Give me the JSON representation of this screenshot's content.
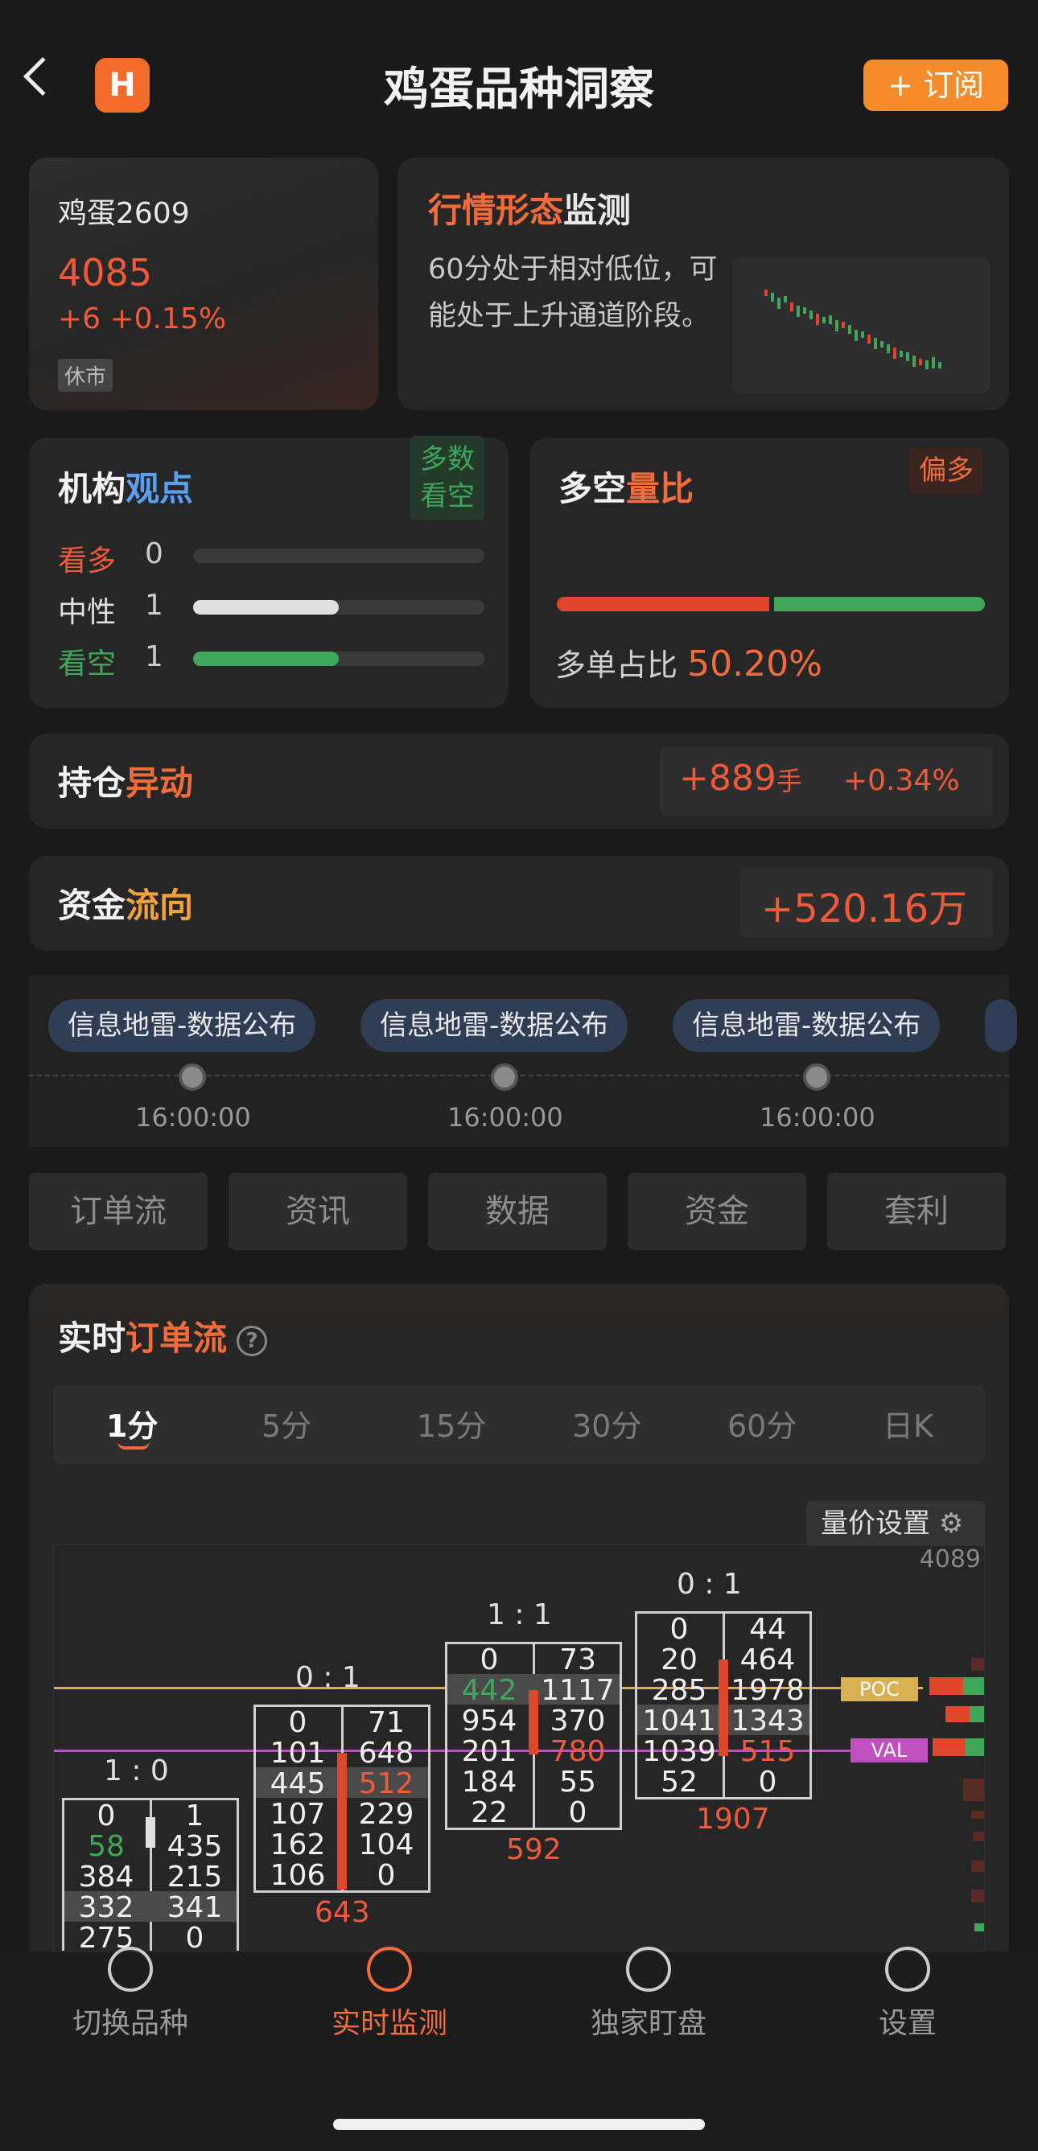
{
  "header": {
    "title": "鸡蛋品种洞察",
    "subscribe_label": "+ 订阅",
    "logo_glyph": "H"
  },
  "price_card": {
    "name": "鸡蛋2609",
    "price": "4085",
    "change": "+6 +0.15%",
    "status": "休市"
  },
  "monitor": {
    "title_a": "行情形态",
    "title_b": "监测",
    "text": "60分处于相对低位，可能处于上升通道阶段。"
  },
  "opinion": {
    "title_a": "机构",
    "title_b": "观点",
    "tag": "多数看空",
    "rows": [
      {
        "label": "看多",
        "count": "0",
        "fraction": 0.0,
        "color": "#f05a3a"
      },
      {
        "label": "中性",
        "count": "1",
        "fraction": 0.5,
        "color": "#e0e0e0"
      },
      {
        "label": "看空",
        "count": "1",
        "fraction": 0.5,
        "color": "#3fa65a"
      }
    ]
  },
  "ratio": {
    "title_a": "多空",
    "title_b": "量比",
    "tag": "偏多",
    "long_label": "多单占比",
    "long_value": "50.20%",
    "long_fraction": 0.502
  },
  "position": {
    "title_a": "持仓",
    "title_b": "异动",
    "value": "+889",
    "unit": "手",
    "pct": "+0.34%"
  },
  "fund": {
    "title_a": "资金",
    "title_b": "流向",
    "value": "+520.16万"
  },
  "timeline": [
    {
      "label": "信息地雷-数据公布",
      "time": "16:00:00"
    },
    {
      "label": "信息地雷-数据公布",
      "time": "16:00:00"
    },
    {
      "label": "信息地雷-数据公布",
      "time": "16:00:00"
    }
  ],
  "tabs": [
    "订单流",
    "资讯",
    "数据",
    "资金",
    "套利"
  ],
  "orderflow": {
    "title_a": "实时",
    "title_b": "订单流",
    "periods": [
      "1分",
      "5分",
      "15分",
      "30分",
      "60分",
      "日K"
    ],
    "active_period": "1分",
    "settings_label": "量价设置",
    "top_price": "4089",
    "poc_label": "POC",
    "val_label": "VAL",
    "candles": [
      {
        "ratio": "1 : 0",
        "total": "",
        "rows": [
          [
            "0",
            "1"
          ],
          [
            "58",
            "435"
          ],
          [
            "384",
            "215"
          ],
          [
            "332",
            "341"
          ],
          [
            "275",
            "0"
          ]
        ]
      },
      {
        "ratio": "0 : 1",
        "total": "643",
        "rows": [
          [
            "0",
            "71"
          ],
          [
            "101",
            "648"
          ],
          [
            "445",
            "512"
          ],
          [
            "107",
            "229"
          ],
          [
            "162",
            "104"
          ],
          [
            "106",
            "0"
          ]
        ]
      },
      {
        "ratio": "1 : 1",
        "total": "592",
        "rows": [
          [
            "0",
            "73"
          ],
          [
            "442",
            "1117"
          ],
          [
            "954",
            "370"
          ],
          [
            "201",
            "780"
          ],
          [
            "184",
            "55"
          ],
          [
            "22",
            "0"
          ]
        ]
      },
      {
        "ratio": "0 : 1",
        "total": "1907",
        "rows": [
          [
            "0",
            "44"
          ],
          [
            "20",
            "464"
          ],
          [
            "285",
            "1978"
          ],
          [
            "1041",
            "1343"
          ],
          [
            "1039",
            "515"
          ],
          [
            "52",
            "0"
          ]
        ]
      }
    ]
  },
  "bottom_nav": [
    {
      "label": "切换品种",
      "icon": "switch-icon",
      "active": false
    },
    {
      "label": "实时监测",
      "icon": "target-icon",
      "active": true
    },
    {
      "label": "独家盯盘",
      "icon": "watch-icon",
      "active": false
    },
    {
      "label": "设置",
      "icon": "settings-icon",
      "active": false
    }
  ]
}
